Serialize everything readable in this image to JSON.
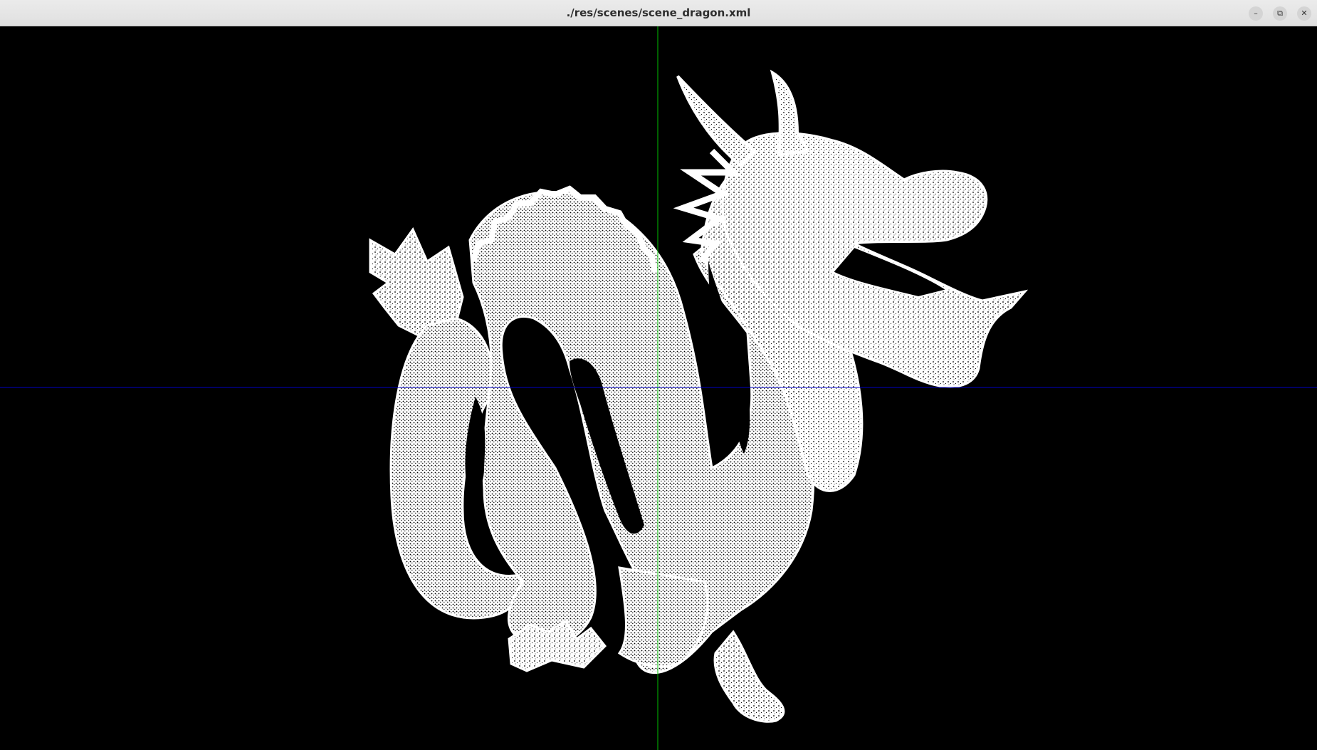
{
  "window": {
    "title": "./res/scenes/scene_dragon.xml",
    "buttons": {
      "minimize": "–",
      "maximize": "⧉",
      "close": "✕"
    }
  },
  "viewport": {
    "background": "#000000",
    "axis_colors": {
      "vertical": "#00c000",
      "horizontal": "#0000c8"
    },
    "model": {
      "name": "dragon",
      "render_mode": "wireframe",
      "color": "#ffffff"
    }
  }
}
